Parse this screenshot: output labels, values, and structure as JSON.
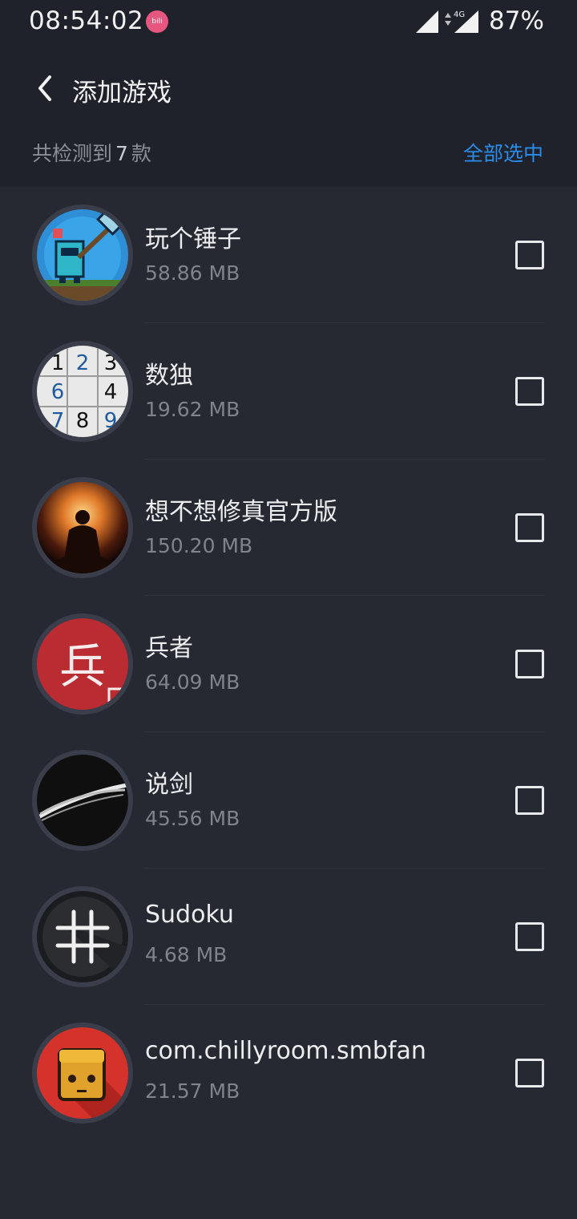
{
  "status": {
    "time": "08:54:02",
    "battery": "87%",
    "network": "4G",
    "notif_icon": "bilibili-icon"
  },
  "header": {
    "title": "添加游戏",
    "back_icon": "chevron-left-icon"
  },
  "summary": {
    "prefix": "共检测到",
    "count": "7",
    "suffix": "款",
    "select_all": "全部选中"
  },
  "games": [
    {
      "name": "玩个锤子",
      "size": "58.86 MB",
      "checked": false
    },
    {
      "name": "数独",
      "size": "19.62 MB",
      "checked": false
    },
    {
      "name": "想不想修真官方版",
      "size": "150.20 MB",
      "checked": false
    },
    {
      "name": "兵者",
      "size": "64.09 MB",
      "checked": false
    },
    {
      "name": "说剑",
      "size": "45.56 MB",
      "checked": false
    },
    {
      "name": "Sudoku",
      "size": "4.68 MB",
      "checked": false
    },
    {
      "name": "com.chillyroom.smbfan",
      "size": "21.57 MB",
      "checked": false
    }
  ],
  "icon_art": {
    "sudoku_digits": [
      "1",
      "2",
      "3",
      "6",
      "",
      "4",
      "7",
      "8",
      "9"
    ],
    "bingzhe_glyph": "兵"
  },
  "colors": {
    "accent": "#2b8cea",
    "background": "#262932",
    "header_bg": "#1f222a"
  }
}
